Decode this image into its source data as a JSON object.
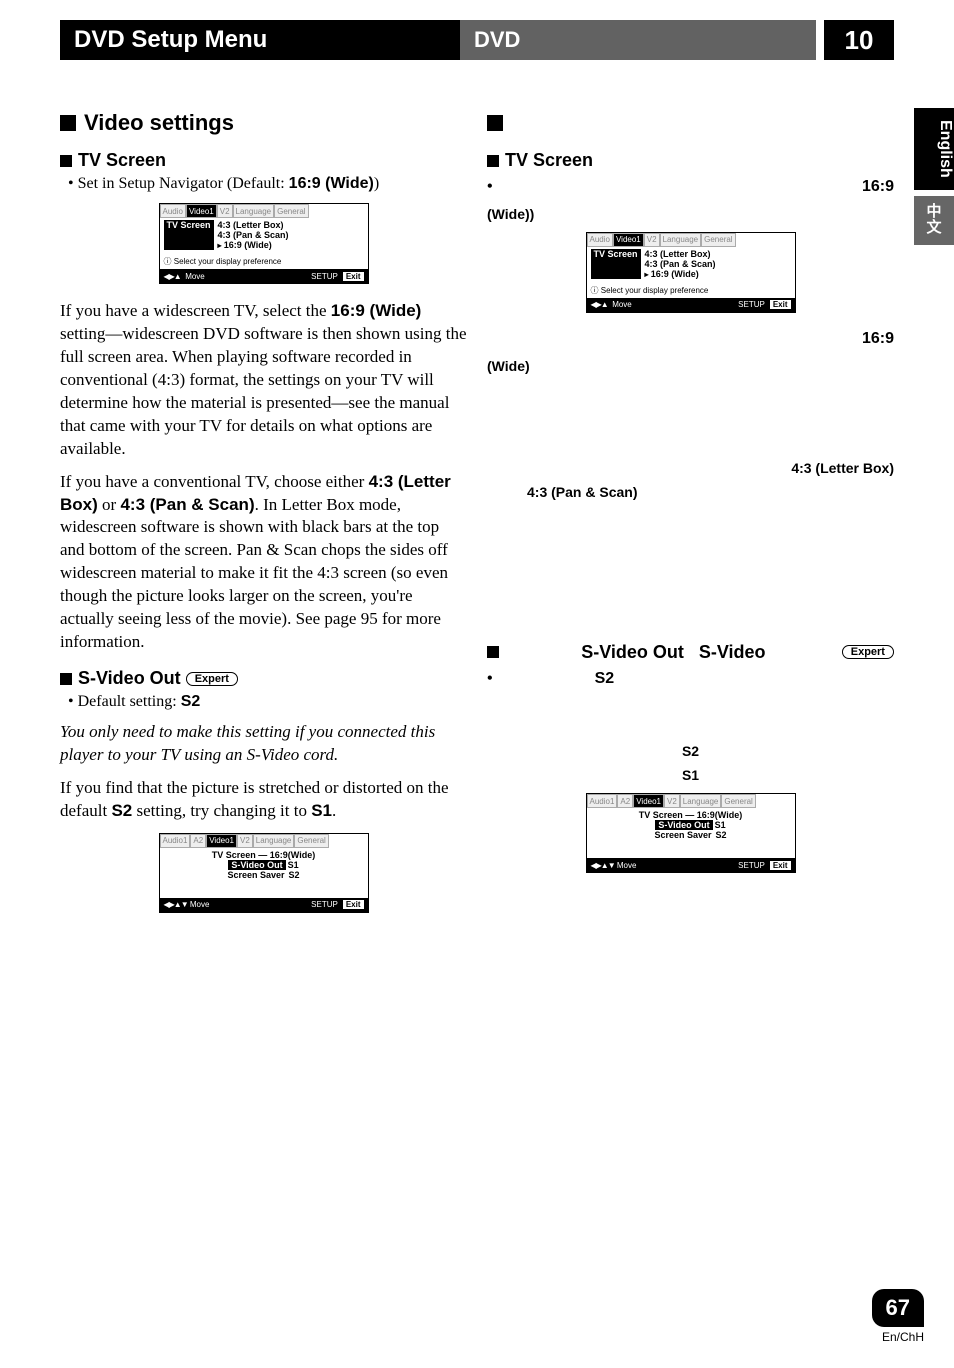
{
  "header": {
    "title_left": "DVD Setup Menu",
    "title_mid": "DVD",
    "chapter_num": "10"
  },
  "side": {
    "lang1": "English",
    "lang2_icons": "中\n文"
  },
  "left": {
    "video_settings": "Video settings",
    "tv_screen": "TV Screen",
    "tv_screen_bullet_pre": "• Set in Setup Navigator (Default: ",
    "tv_screen_default": "16:9 (Wide)",
    "tv_screen_bullet_post": ")",
    "para1_a": "If you have a widescreen TV, select the ",
    "para1_b": "16:9 (Wide)",
    "para1_c": " setting—widescreen DVD software is then shown using the full screen area. When playing software recorded in conventional (4:3) format, the settings on your TV will determine how the material is presented—see the manual that came with your TV for details on what options are available.",
    "para2_a": "If you have a conventional TV, choose either ",
    "para2_b": "4:3 (Letter Box)",
    "para2_c": " or ",
    "para2_d": "4:3 (Pan & Scan)",
    "para2_e": ". In Letter Box mode, widescreen software is shown with black bars at the top and bottom of the screen. Pan & Scan chops the sides off widescreen material to make it fit the 4:3 screen (so even though the picture looks larger on the screen, you're actually seeing less of the movie). See page 95 for more information.",
    "svideo_hd": "S-Video Out",
    "expert": "Expert",
    "svideo_bullet_a": "•  Default setting: ",
    "svideo_bullet_b": "S2",
    "svideo_p1": "You only need to make this setting if you connected this player to your TV using an S-Video cord.",
    "svideo_p2_a": "If you find that the picture is stretched or distorted on the default ",
    "svideo_p2_b": "S2",
    "svideo_p2_c": " setting, try changing it to ",
    "svideo_p2_d": "S1",
    "svideo_p2_e": "."
  },
  "right": {
    "tv_screen": "TV Screen",
    "bullet_dot": "•",
    "wide_paren": "(Wide))",
    "val_169": "16:9",
    "wide_alone": "(Wide)",
    "letterbox": "4:3 (Letter Box)",
    "panscan": "4:3 (Pan & Scan)",
    "svideo_hd": "S-Video Out   S-Video",
    "s2": "S2",
    "s1": "S1"
  },
  "osd1": {
    "tabs": [
      "Audio",
      "Video1",
      "V2",
      "Language",
      "General"
    ],
    "active": 1,
    "label": "TV Screen",
    "opts": [
      "4:3 (Letter Box)",
      "4:3 (Pan & Scan)",
      "16:9 (Wide)"
    ],
    "sel": 2,
    "info": "Select your display preference",
    "foot_left_glyphs": "◀▶▲",
    "foot_move": "Move",
    "foot_setup": "SETUP",
    "foot_exit": "Exit"
  },
  "osd2": {
    "tabs": [
      "Audio1",
      "A2",
      "Video1",
      "V2",
      "Language",
      "General"
    ],
    "active": 2,
    "rows": [
      {
        "lab": "TV Screen",
        "val": "— 16:9(Wide)"
      },
      {
        "lab": "S-Video Out",
        "val": "S1",
        "hl": true
      },
      {
        "lab": "Screen Saver",
        "val": "S2",
        "sel": true
      }
    ],
    "foot_left_glyphs": "◀▶▲▼",
    "foot_move": "Move",
    "foot_setup": "SETUP",
    "foot_exit": "Exit"
  },
  "footer": {
    "page": "67",
    "langs": "En/ChH"
  }
}
